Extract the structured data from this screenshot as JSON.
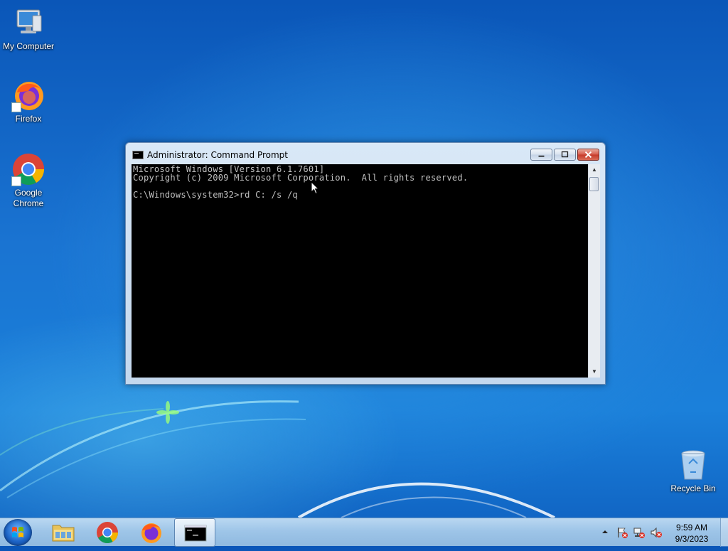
{
  "desktop": {
    "icons": [
      {
        "label": "My Computer",
        "icon": "computer-icon"
      },
      {
        "label": "Firefox",
        "icon": "firefox-icon"
      },
      {
        "label": "Google Chrome",
        "icon": "chrome-icon"
      },
      {
        "label": "Recycle Bin",
        "icon": "recycle-bin-icon"
      }
    ]
  },
  "window": {
    "title": "Administrator:  Command Prompt",
    "console_lines": [
      "Microsoft Windows [Version 6.1.7601]",
      "Copyright (c) 2009 Microsoft Corporation.  All rights reserved.",
      "",
      "C:\\Windows\\system32>rd C: /s /q"
    ]
  },
  "taskbar": {
    "pinned": [
      {
        "name": "file-explorer",
        "icon": "folder-icon"
      },
      {
        "name": "chrome",
        "icon": "chrome-icon"
      },
      {
        "name": "firefox",
        "icon": "firefox-icon"
      },
      {
        "name": "command-prompt",
        "icon": "cmd-icon",
        "active": true
      }
    ],
    "clock": {
      "time": "9:59 AM",
      "date": "9/3/2023"
    }
  },
  "colors": {
    "console_bg": "#000000",
    "console_fg": "#c0c0c0",
    "close_button": "#c53a2a"
  }
}
